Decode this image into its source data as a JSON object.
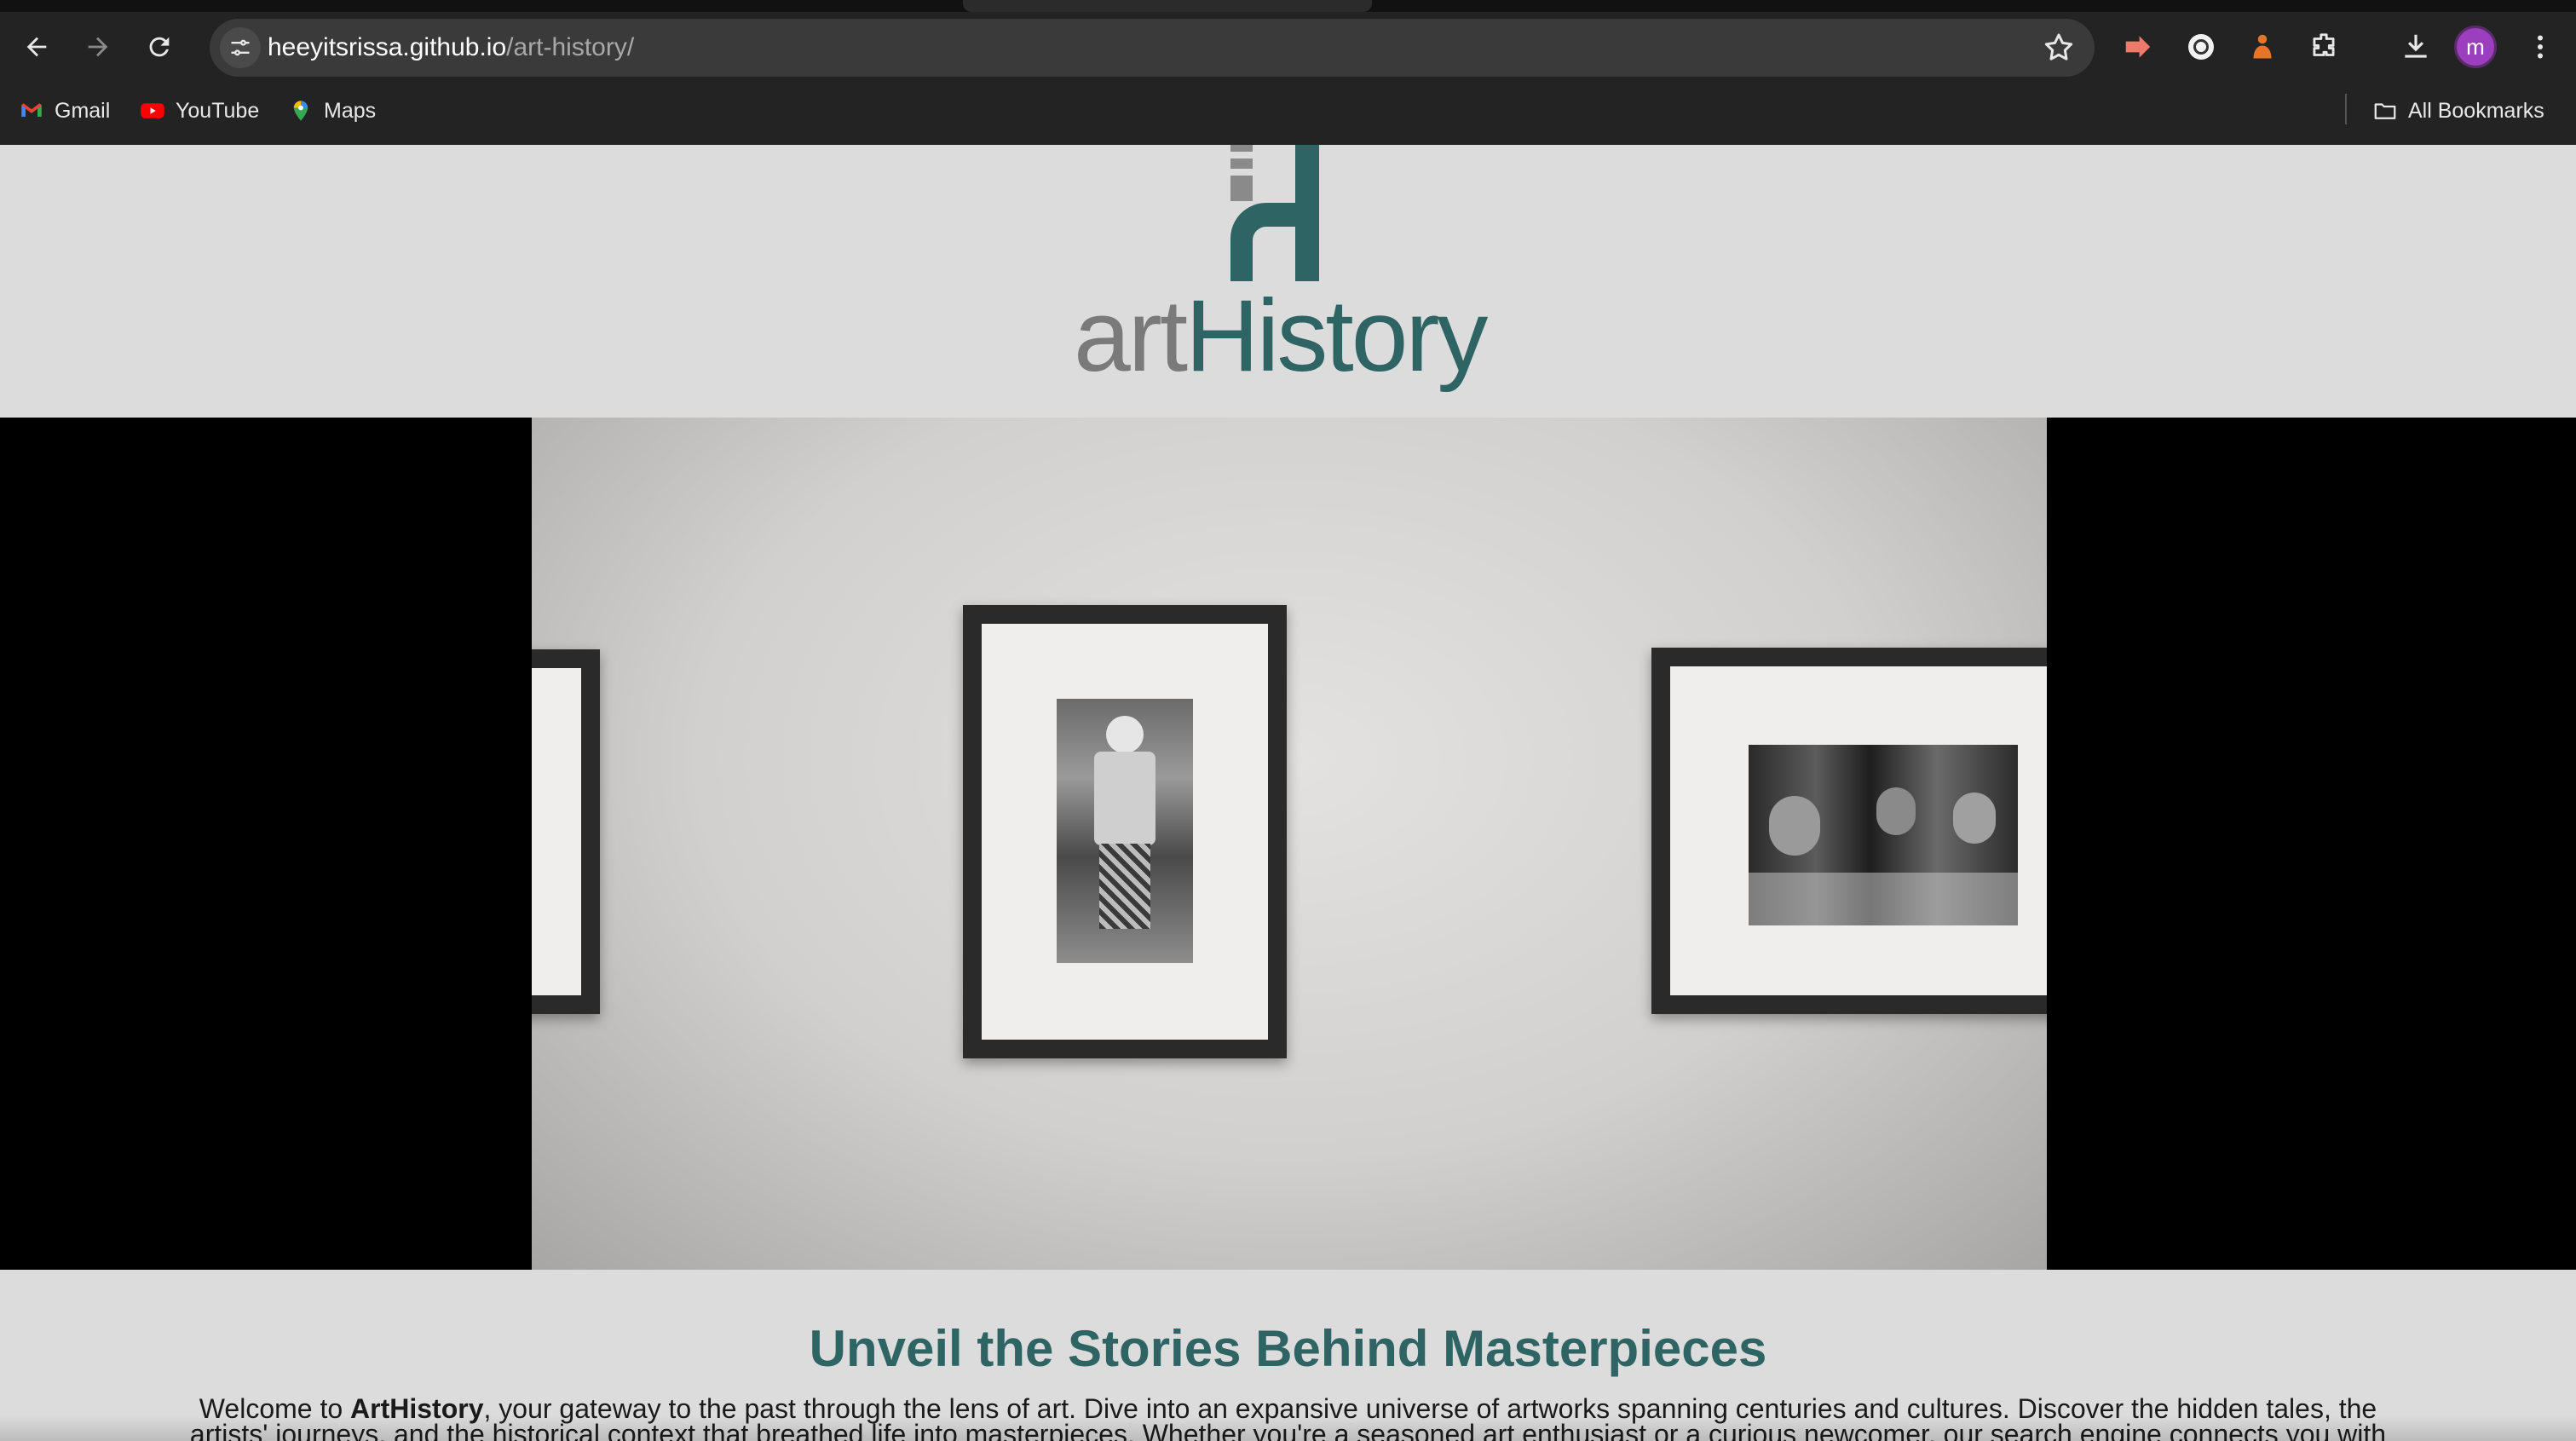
{
  "browser": {
    "url_host": "heeyitsrissa.github.io",
    "url_path": "/art-history/",
    "nav_icons": [
      "back-arrow-icon",
      "forward-arrow-icon",
      "reload-icon"
    ],
    "extensions": [
      "extension-red-arrow-icon",
      "extension-circle-icon",
      "extension-orange-icon",
      "puzzle-extensions-icon",
      "download-icon"
    ],
    "profile_initial": "m",
    "profile_color": "#9b3fbf",
    "bookmarks": [
      {
        "label": "Gmail",
        "icon": "gmail-icon"
      },
      {
        "label": "YouTube",
        "icon": "youtube-icon"
      },
      {
        "label": "Maps",
        "icon": "maps-pin-icon"
      }
    ],
    "all_bookmarks_label": "All Bookmarks"
  },
  "site": {
    "logo_text_light": "art",
    "logo_text_dark": "History",
    "logo_color": "#2f6464",
    "hero_alt": "gallery wall with framed black and white photographs",
    "headline": "Unveil the Stories Behind Masterpieces",
    "intro_prefix": "Welcome to ",
    "intro_brand": "ArtHistory",
    "intro_body": ", your gateway to the past through the lens of art. Dive into an expansive universe of artworks spanning centuries and cultures. Discover the hidden tales, the artists' journeys, and the historical context that breathed life into masterpieces. Whether you're a seasoned art enthusiast or a curious newcomer, our search engine connects you with the rich"
  }
}
